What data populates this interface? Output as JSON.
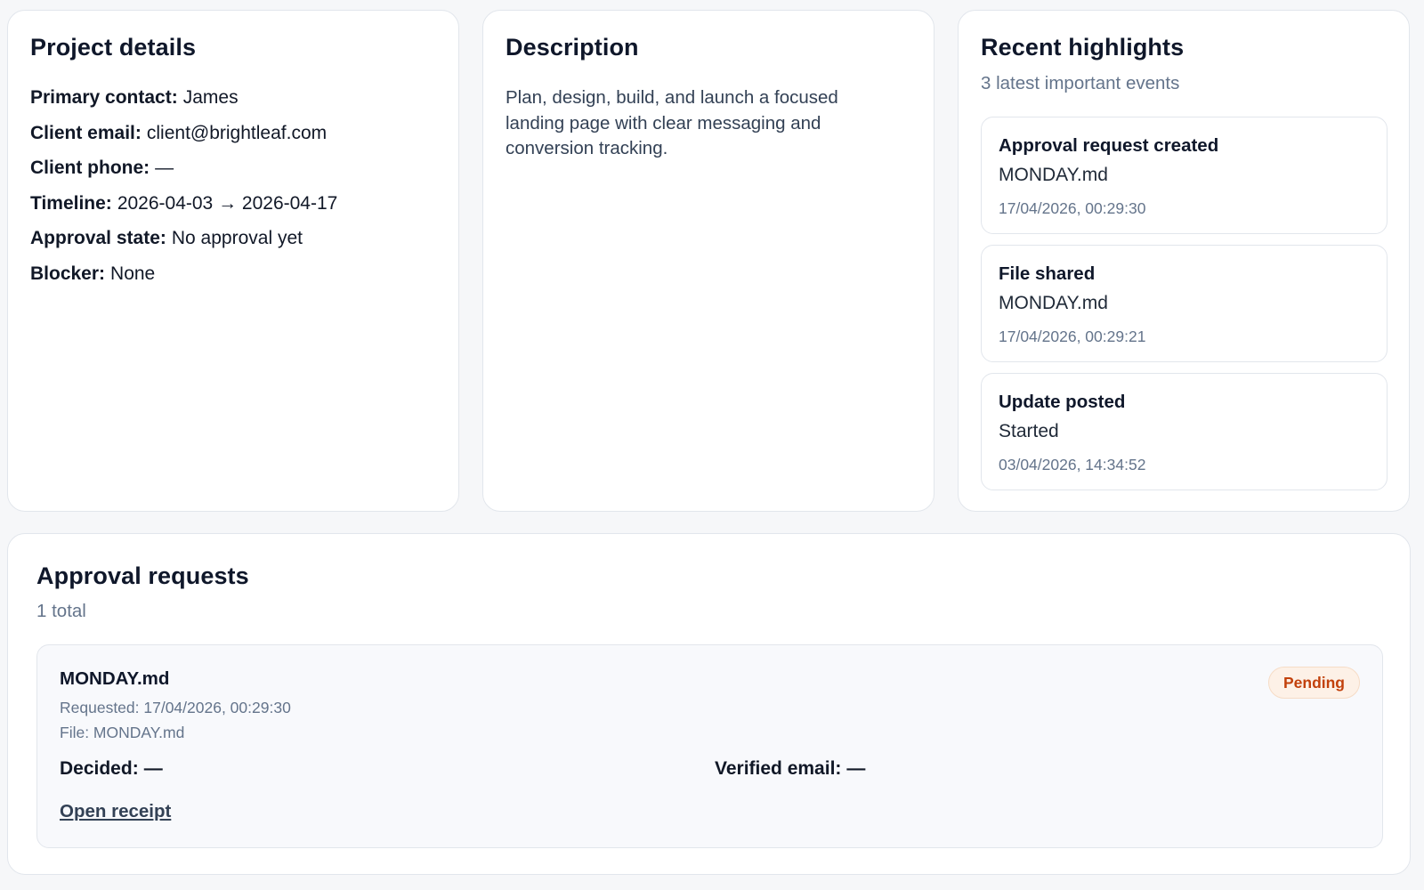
{
  "project_details": {
    "title": "Project details",
    "rows": [
      {
        "label": "Primary contact:",
        "value": "James"
      },
      {
        "label": "Client email:",
        "value": "client@brightleaf.com"
      },
      {
        "label": "Client phone:",
        "value": "—"
      },
      {
        "label": "Timeline:",
        "value": "2026-04-03 → 2026-04-17"
      },
      {
        "label": "Approval state:",
        "value": "No approval yet"
      },
      {
        "label": "Blocker:",
        "value": "None"
      }
    ]
  },
  "description": {
    "title": "Description",
    "text": "Plan, design, build, and launch a focused landing page with clear messaging and conversion tracking."
  },
  "highlights": {
    "title": "Recent highlights",
    "subtitle": "3 latest important events",
    "events": [
      {
        "title": "Approval request created",
        "detail": "MONDAY.md",
        "time": "17/04/2026, 00:29:30"
      },
      {
        "title": "File shared",
        "detail": "MONDAY.md",
        "time": "17/04/2026, 00:29:21"
      },
      {
        "title": "Update posted",
        "detail": "Started",
        "time": "03/04/2026, 14:34:52"
      }
    ]
  },
  "approvals": {
    "title": "Approval requests",
    "subtitle": "1 total",
    "requests": [
      {
        "name": "MONDAY.md",
        "requested": "Requested: 17/04/2026, 00:29:30",
        "file": "File: MONDAY.md",
        "status": "Pending",
        "decided_label": "Decided:",
        "decided_value": "—",
        "verified_label": "Verified email:",
        "verified_value": "—",
        "receipt_link": "Open receipt"
      }
    ]
  },
  "colors": {
    "page_background": "#f6f7f9",
    "card_border": "#e2e6ec",
    "muted_text": "#64748b",
    "pending_text": "#c2410c",
    "pending_background": "#fdf1e7"
  }
}
